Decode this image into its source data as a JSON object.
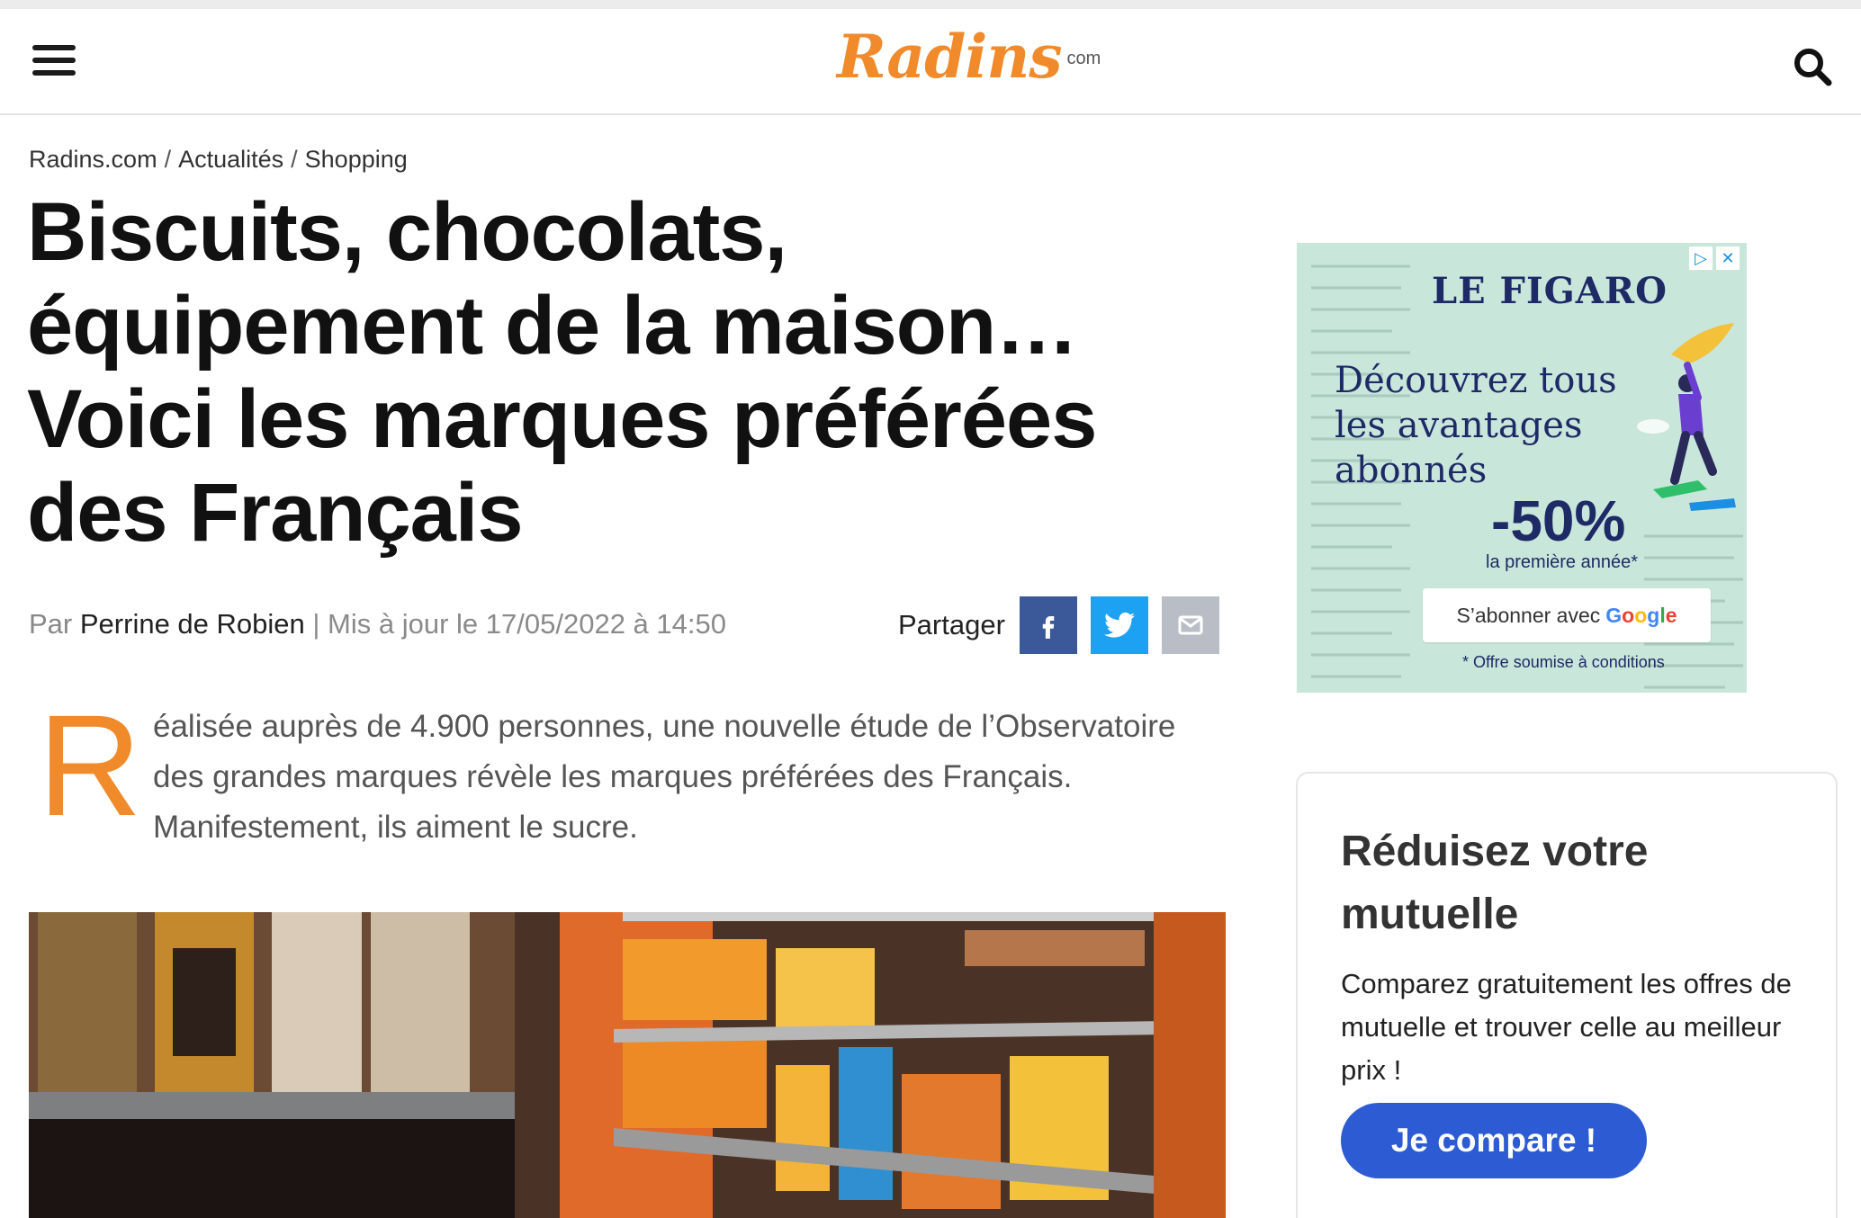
{
  "header": {
    "logo_text": "Radins",
    "logo_suffix": "com",
    "menu_icon": "hamburger-icon",
    "search_icon": "search-icon"
  },
  "breadcrumb": [
    "Radins.com",
    "Actualités",
    "Shopping"
  ],
  "article": {
    "headline": "Biscuits, chocolats, équipement de la maison… Voici les marques préférées des Français",
    "by_label": "Par",
    "author": "Perrine de Robien",
    "updated": "| Mis à jour le 17/05/2022 à 14:50",
    "share_label": "Partager",
    "lead_dropcap": "R",
    "lead_text": "éalisée auprès de 4.900 personnes, une nouvelle étude de l’Observatoire des grandes marques révèle les marques préférées des Français. Manifestement, ils aiment le sucre."
  },
  "ad": {
    "brand": "LE FIGARO",
    "headline": "Découvrez tous les avantages abonnés",
    "promo": "-50%",
    "promo_sub": "la première année*",
    "cta_prefix": "S’abonner avec",
    "cta_brand": "Google",
    "note": "* Offre soumise à conditions"
  },
  "card": {
    "title": "Réduisez votre mutuelle",
    "text": "Comparez gratuitement les offres de mutuelle et trouver celle au meilleur prix !",
    "button": "Je compare !"
  },
  "colors": {
    "brand_orange": "#f08a2b",
    "facebook": "#3b5998",
    "twitter": "#1da1f2",
    "mail": "#b9bec6",
    "cta_blue": "#2d5bd3",
    "ad_bg": "#c9e6db",
    "ad_ink": "#1e2a66"
  }
}
